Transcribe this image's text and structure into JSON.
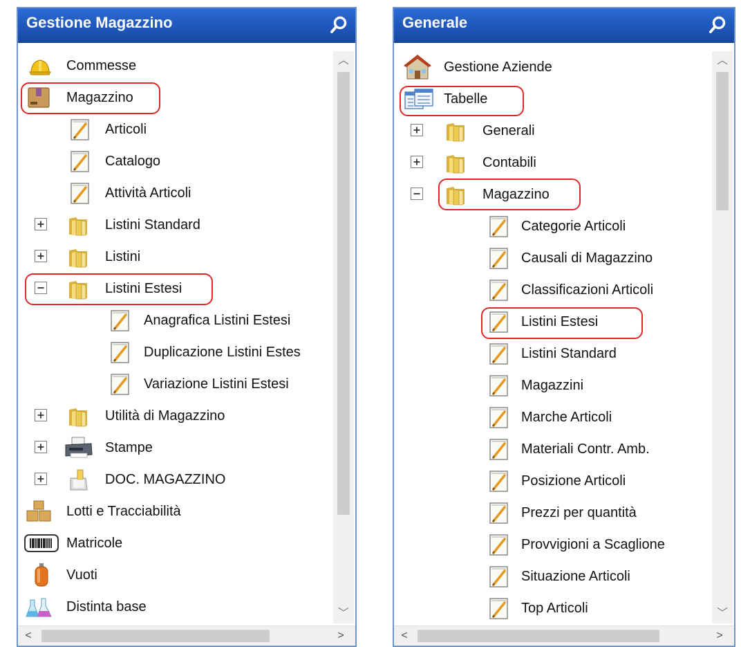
{
  "left_panel": {
    "title": "Gestione Magazzino",
    "items": [
      {
        "label": "Commesse",
        "icon": "hardhat-icon",
        "expander": null
      },
      {
        "label": "Magazzino",
        "icon": "warehouse-box-icon",
        "expander": null
      },
      {
        "label": "Articoli",
        "icon": "notepad-icon",
        "expander": null
      },
      {
        "label": "Catalogo",
        "icon": "notepad-icon",
        "expander": null
      },
      {
        "label": "Attività Articoli",
        "icon": "notepad-icon",
        "expander": null
      },
      {
        "label": "Listini Standard",
        "icon": "folder-icon",
        "expander": "plus"
      },
      {
        "label": "Listini",
        "icon": "folder-icon",
        "expander": "plus"
      },
      {
        "label": "Listini Estesi",
        "icon": "folder-icon",
        "expander": "minus"
      },
      {
        "label": "Anagrafica Listini Estesi",
        "icon": "notepad-icon",
        "expander": null
      },
      {
        "label": "Duplicazione Listini Estes",
        "icon": "notepad-icon",
        "expander": null
      },
      {
        "label": "Variazione Listini Estesi",
        "icon": "notepad-icon",
        "expander": null
      },
      {
        "label": "Utilità di Magazzino",
        "icon": "folder-icon",
        "expander": "plus"
      },
      {
        "label": "Stampe",
        "icon": "printer-icon",
        "expander": "plus"
      },
      {
        "label": "DOC. MAGAZZINO",
        "icon": "folder-icon",
        "expander": "plus"
      },
      {
        "label": "Lotti e Tracciabilità",
        "icon": "boxes-icon",
        "expander": null
      },
      {
        "label": "Matricole",
        "icon": "barcode-icon",
        "expander": null
      },
      {
        "label": "Vuoti",
        "icon": "gas-bottle-icon",
        "expander": null
      },
      {
        "label": "Distinta base",
        "icon": "flasks-icon",
        "expander": null
      }
    ]
  },
  "right_panel": {
    "title": "Generale",
    "items": [
      {
        "label": "Gestione Aziende",
        "icon": "house-icon",
        "expander": null
      },
      {
        "label": "Tabelle",
        "icon": "tables-icon",
        "expander": null
      },
      {
        "label": "Generali",
        "icon": "folder-icon",
        "expander": "plus"
      },
      {
        "label": "Contabili",
        "icon": "folder-icon",
        "expander": "plus"
      },
      {
        "label": "Magazzino",
        "icon": "folder-icon",
        "expander": "minus"
      },
      {
        "label": "Categorie Articoli",
        "icon": "notepad-icon",
        "expander": null
      },
      {
        "label": "Causali di Magazzino",
        "icon": "notepad-icon",
        "expander": null
      },
      {
        "label": "Classificazioni Articoli",
        "icon": "notepad-icon",
        "expander": null
      },
      {
        "label": "Listini Estesi",
        "icon": "notepad-icon",
        "expander": null
      },
      {
        "label": "Listini Standard",
        "icon": "notepad-icon",
        "expander": null
      },
      {
        "label": "Magazzini",
        "icon": "notepad-icon",
        "expander": null
      },
      {
        "label": "Marche Articoli",
        "icon": "notepad-icon",
        "expander": null
      },
      {
        "label": "Materiali Contr. Amb.",
        "icon": "notepad-icon",
        "expander": null
      },
      {
        "label": "Posizione Articoli",
        "icon": "notepad-icon",
        "expander": null
      },
      {
        "label": "Prezzi per quantità",
        "icon": "notepad-icon",
        "expander": null
      },
      {
        "label": "Provvigioni a Scaglione",
        "icon": "notepad-icon",
        "expander": null
      },
      {
        "label": "Situazione Articoli",
        "icon": "notepad-icon",
        "expander": null
      },
      {
        "label": "Top Articoli",
        "icon": "notepad-icon",
        "expander": null
      }
    ]
  },
  "colors": {
    "header_blue": "#1f57bb",
    "highlight_red": "#e02626",
    "folder_yellow": "#f2cf5a"
  }
}
